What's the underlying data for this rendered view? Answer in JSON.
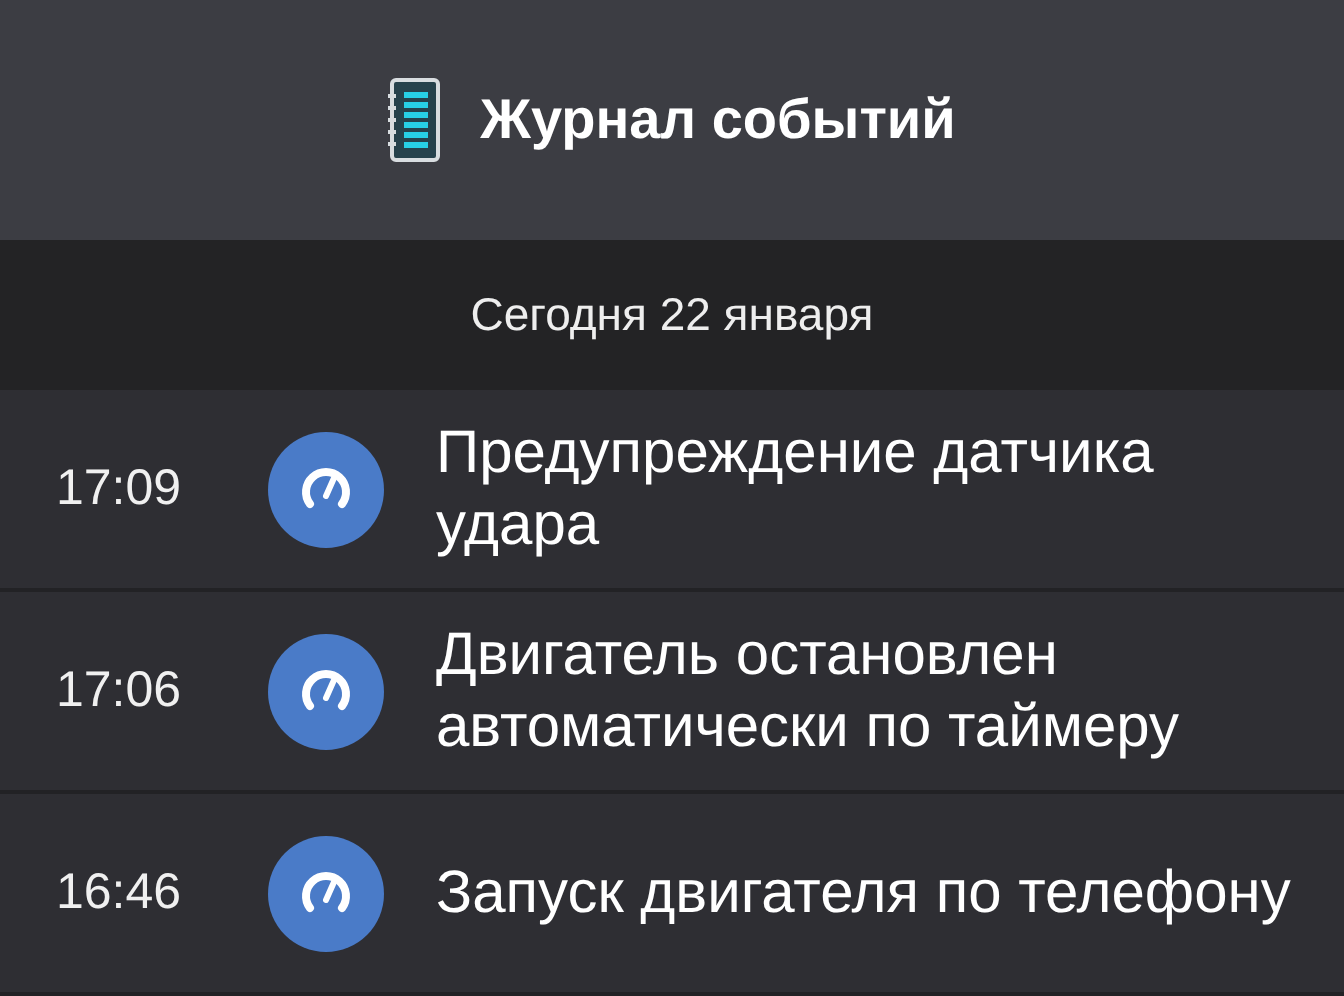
{
  "header": {
    "title": "Журнал событий"
  },
  "date_bar": {
    "label": "Сегодня 22 января"
  },
  "events": [
    {
      "time": "17:09",
      "text": "Предупреждение датчика удара"
    },
    {
      "time": "17:06",
      "text": "Двигатель остановлен автоматически по таймеру"
    },
    {
      "time": "16:46",
      "text": "Запуск двигателя по телефону"
    }
  ]
}
